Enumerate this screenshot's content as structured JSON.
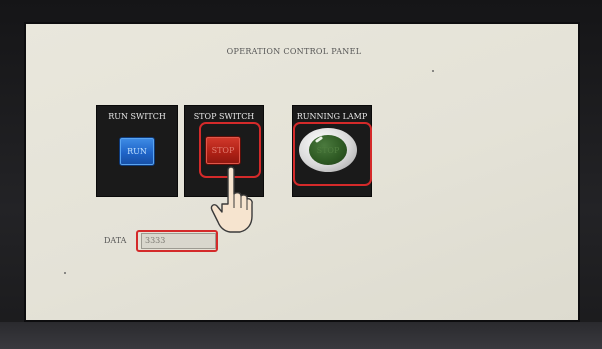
{
  "screen": {
    "title": "OPERATION CONTROL PANEL"
  },
  "panels": {
    "run_switch": {
      "label": "RUN SWITCH",
      "button_text": "RUN"
    },
    "stop_switch": {
      "label": "STOP SWITCH",
      "button_text": "STOP"
    },
    "running_lamp": {
      "label": "RUNNING LAMP",
      "lamp_text": "STOP"
    }
  },
  "data": {
    "label": "DATA",
    "value": "3333"
  },
  "colors": {
    "highlight_box": "#d42a2a",
    "run_button": "#1f64c8",
    "stop_button": "#b02116",
    "lamp_off": "#2f5b24"
  },
  "icons": {
    "pointer": "pointing-hand-icon"
  }
}
